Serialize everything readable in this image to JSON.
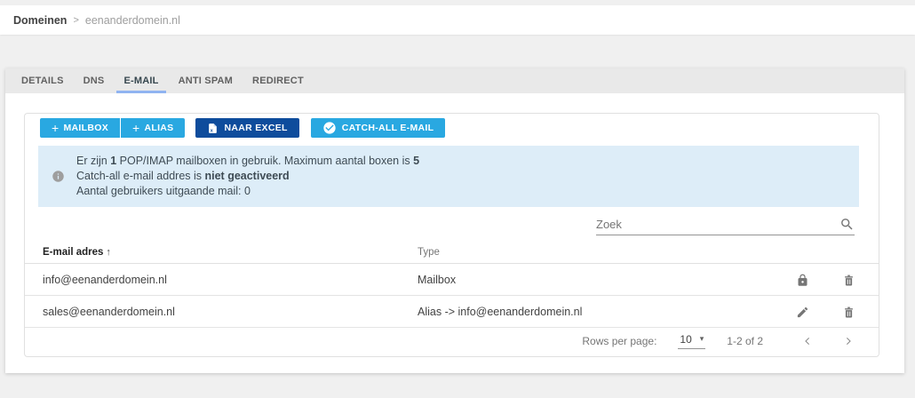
{
  "breadcrumb": {
    "root": "Domeinen",
    "separator": ">",
    "current": "eenanderdomein.nl"
  },
  "tabs": [
    {
      "label": "DETAILS"
    },
    {
      "label": "DNS"
    },
    {
      "label": "E-MAIL"
    },
    {
      "label": "ANTI SPAM"
    },
    {
      "label": "REDIRECT"
    }
  ],
  "active_tab": "E-MAIL",
  "toolbar": {
    "plus": "+",
    "mailbox": "MAILBOX",
    "alias": "ALIAS",
    "excel": "NAAR EXCEL",
    "catchall": "CATCH-ALL E-MAIL"
  },
  "info_lines": [
    {
      "segments": [
        "Er zijn ",
        "1",
        " POP/IMAP mailboxen in gebruik. Maximum aantal boxen is ",
        "5"
      ]
    },
    {
      "segments": [
        "Catch-all e-mail addres is ",
        "niet geactiveerd"
      ]
    },
    {
      "segments": [
        "Aantal gebruikers uitgaande mail: 0"
      ]
    }
  ],
  "search": {
    "placeholder": "Zoek"
  },
  "table": {
    "header_email": "E-mail adres",
    "sort_indicator": "↑",
    "header_type": "Type",
    "rows": [
      {
        "email": "info@eenanderdomein.nl",
        "type": "Mailbox",
        "actions": [
          "lock",
          "delete"
        ]
      },
      {
        "email": "sales@eenanderdomein.nl",
        "type": "Alias -> info@eenanderdomein.nl",
        "actions": [
          "edit",
          "delete"
        ]
      }
    ]
  },
  "pagination": {
    "label": "Rows per page:",
    "value": "10",
    "range": "1-2 of 2"
  },
  "colors": {
    "accent_blue": "#29a8e1",
    "dark_blue": "#0e4c9c",
    "info_bg": "#ddedf8",
    "tab_underline": "#90b4f1",
    "icon_gray": "#757575"
  }
}
